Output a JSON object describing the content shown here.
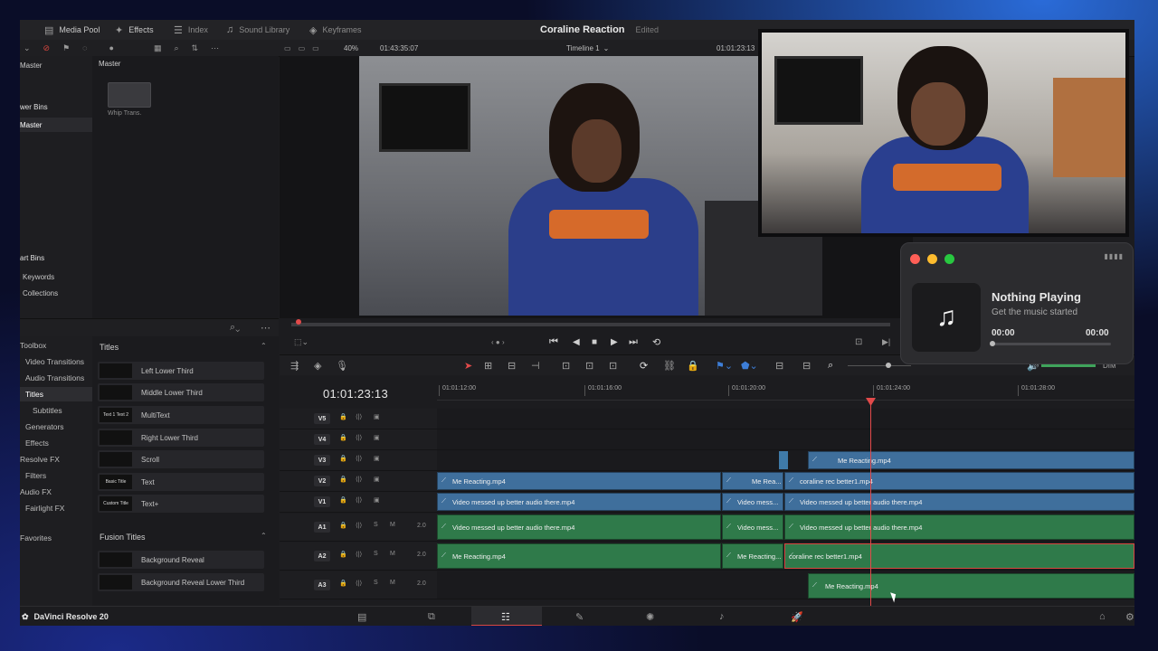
{
  "topbar": {
    "tabs": [
      {
        "label": "Media Pool",
        "icon": "media-pool-icon"
      },
      {
        "label": "Effects",
        "icon": "effects-icon"
      },
      {
        "label": "Index",
        "icon": "index-icon"
      },
      {
        "label": "Sound Library",
        "icon": "sound-library-icon"
      },
      {
        "label": "Keyframes",
        "icon": "keyframes-icon"
      }
    ],
    "project_title": "Coraline Reaction",
    "project_status": "Edited"
  },
  "viewer_bar": {
    "zoom": "40%",
    "source_timecode": "01:43:35:07",
    "timeline_name": "Timeline 1",
    "record_timecode": "01:01:23:13"
  },
  "media_pool": {
    "left_header": "Master",
    "power_bins": "wer Bins",
    "master_bin": "Master",
    "smart_bins": "art Bins",
    "keywords": "Keywords",
    "collections": "Collections",
    "right_header": "Master",
    "clip_label": "Whip Trans."
  },
  "effects": {
    "categories": [
      "Toolbox",
      "Video Transitions",
      "Audio Transitions",
      "Titles",
      "Subtitles",
      "Generators",
      "Effects",
      "Resolve FX",
      "Filters",
      "Audio FX",
      "Fairlight FX",
      "Favorites"
    ],
    "titles_header": "Titles",
    "titles": [
      {
        "name": "Left Lower Third",
        "thumb": ""
      },
      {
        "name": "Middle Lower Third",
        "thumb": ""
      },
      {
        "name": "MultiText",
        "thumb": "Text 1 Text 2"
      },
      {
        "name": "Right Lower Third",
        "thumb": ""
      },
      {
        "name": "Scroll",
        "thumb": ""
      },
      {
        "name": "Text",
        "thumb": "Basic Title"
      },
      {
        "name": "Text+",
        "thumb": "Custom Title"
      }
    ],
    "fusion_header": "Fusion Titles",
    "fusion_titles": [
      {
        "name": "Background Reveal"
      },
      {
        "name": "Background Reveal Lower Third"
      }
    ]
  },
  "timeline": {
    "timecode": "01:01:23:13",
    "ruler": [
      "01:01:12:00",
      "01:01:16:00",
      "01:01:20:00",
      "01:01:24:00",
      "01:01:28:00"
    ],
    "tracks": [
      {
        "name": "V5"
      },
      {
        "name": "V4"
      },
      {
        "name": "V3"
      },
      {
        "name": "V2"
      },
      {
        "name": "V1"
      },
      {
        "name": "A1",
        "ch": "2.0"
      },
      {
        "name": "A2",
        "ch": "2.0"
      },
      {
        "name": "A3",
        "ch": "2.0"
      }
    ],
    "clips": {
      "v3_a": "Me Reacting.mp4",
      "v2_a": "Me Reacting.mp4",
      "v2_b": "Me Rea...",
      "v2_c": "coraline rec better1.mp4",
      "v1_a": "Video messed up better audio there.mp4",
      "v1_b": "Video mess...",
      "v1_c": "Video messed up better audio there.mp4",
      "a1_a": "Video messed up better audio there.mp4",
      "a1_b": "Video mess...",
      "a1_c": "Video messed up better audio there.mp4",
      "a2_a": "Me Reacting.mp4",
      "a2_b": "Me Reacting...",
      "a2_c": "coraline rec better1.mp4",
      "a3_a": "Me Reacting.mp4"
    }
  },
  "music_widget": {
    "title": "Nothing Playing",
    "subtitle": "Get the music started",
    "elapsed": "00:00",
    "duration": "00:00",
    "progress": 0
  },
  "pagebar": {
    "brand": "DaVinci Resolve 20"
  },
  "colors": {
    "accent": "#d8473f",
    "video_clip": "#3f6f9c",
    "audio_clip": "#2f7a4a"
  }
}
